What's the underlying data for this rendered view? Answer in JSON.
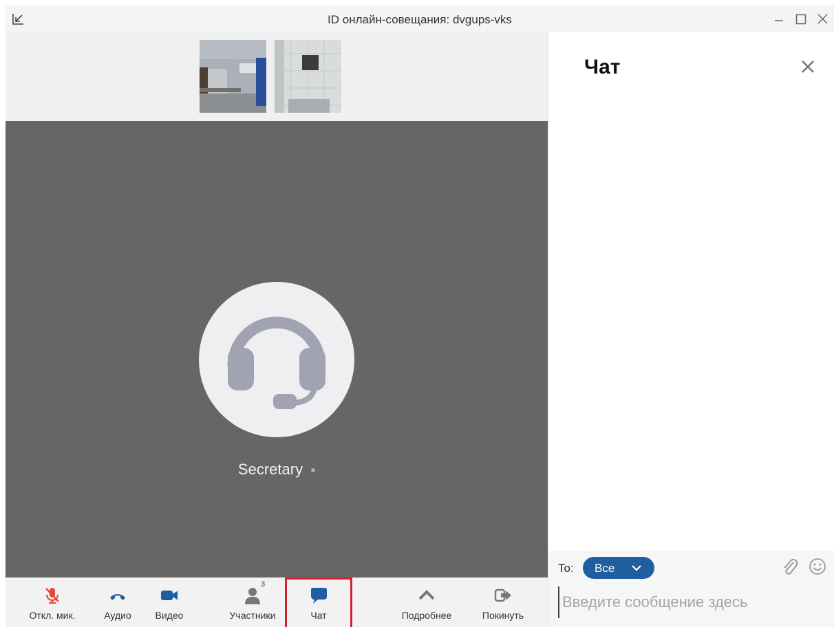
{
  "window": {
    "title": "ID онлайн-совещания: dvgups-vks",
    "controls": [
      "minimize-icon",
      "maximize-icon",
      "close-icon"
    ]
  },
  "meeting": {
    "thumbnails": [
      "camera-feed-1",
      "camera-feed-2"
    ],
    "speaker_name": "Secretary",
    "avatar_icon": "headset-icon"
  },
  "toolbar": {
    "mute_label": "Откл. мик.",
    "audio_label": "Аудио",
    "video_label": "Видео",
    "participants_label": "Участники",
    "participants_count": "3",
    "chat_label": "Чат",
    "more_label": "Подробнее",
    "leave_label": "Покинуть"
  },
  "chat": {
    "title": "Чат",
    "to_label": "To:",
    "recipient": "Все",
    "input_placeholder": "Введите сообщение здесь"
  },
  "colors": {
    "mute_red": "#e8453c",
    "accent_blue": "#1f5fa0",
    "icon_gray": "#777777",
    "highlight_red": "#d2232a",
    "main_video_bg": "#666666"
  }
}
